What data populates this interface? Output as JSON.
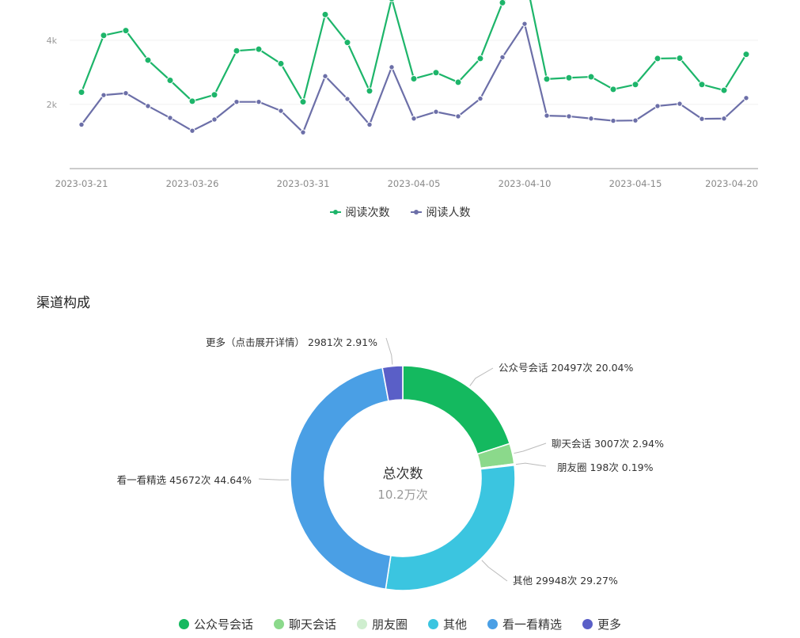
{
  "colors": {
    "reads": "#1db56a",
    "readers": "#6c6fa8",
    "axis": "#cccccc",
    "grid": "#f0f0f0"
  },
  "chart_data": [
    {
      "type": "line",
      "title": "",
      "xlabel": "",
      "ylabel": "",
      "x": [
        "2023-03-21",
        "2023-03-22",
        "2023-03-23",
        "2023-03-24",
        "2023-03-25",
        "2023-03-26",
        "2023-03-27",
        "2023-03-28",
        "2023-03-29",
        "2023-03-30",
        "2023-03-31",
        "2023-04-01",
        "2023-04-02",
        "2023-04-03",
        "2023-04-04",
        "2023-04-05",
        "2023-04-06",
        "2023-04-07",
        "2023-04-08",
        "2023-04-09",
        "2023-04-10",
        "2023-04-11",
        "2023-04-12",
        "2023-04-13",
        "2023-04-14",
        "2023-04-15",
        "2023-04-16",
        "2023-04-17",
        "2023-04-18",
        "2023-04-19",
        "2023-04-20"
      ],
      "x_tick_labels": [
        "2023-03-21",
        "2023-03-26",
        "2023-03-31",
        "2023-04-05",
        "2023-04-10",
        "2023-04-15",
        "2023-04-20"
      ],
      "y_tick_labels": [
        "2k",
        "4k"
      ],
      "y_ticks": [
        2000,
        4000
      ],
      "ylim": [
        0,
        5500
      ],
      "grid": true,
      "legend": "bottom",
      "series": [
        {
          "name": "阅读次数",
          "values": [
            2380,
            4150,
            4300,
            3380,
            2750,
            2100,
            2300,
            3670,
            3720,
            3270,
            2080,
            4800,
            3930,
            2420,
            5300,
            2800,
            2990,
            2690,
            3430,
            5170,
            6100,
            2790,
            2830,
            2860,
            2470,
            2620,
            3430,
            3440,
            2620,
            2440,
            3560
          ]
        },
        {
          "name": "阅读人数",
          "values": [
            1370,
            2290,
            2350,
            1950,
            1580,
            1180,
            1530,
            2080,
            2080,
            1800,
            1130,
            2880,
            2170,
            1370,
            3160,
            1560,
            1770,
            1630,
            2180,
            3470,
            4510,
            1650,
            1630,
            1560,
            1490,
            1500,
            1950,
            2020,
            1550,
            1560,
            2200
          ]
        }
      ]
    },
    {
      "type": "pie",
      "title": "渠道构成",
      "center_label": "总次数",
      "center_value": "10.2万次",
      "legend": "bottom",
      "slices": [
        {
          "name": "公众号会话",
          "value": 20497,
          "label": "公众号会话 20497次 20.04%",
          "color": "#14b95f"
        },
        {
          "name": "聊天会话",
          "value": 3007,
          "label": "聊天会话 3007次 2.94%",
          "color": "#8bd98b"
        },
        {
          "name": "朋友圈",
          "value": 198,
          "label": "朋友圈 198次 0.19%",
          "color": "#cfeecf"
        },
        {
          "name": "其他",
          "value": 29948,
          "label": "其他 29948次 29.27%",
          "color": "#3bc5e0"
        },
        {
          "name": "看一看精选",
          "value": 45672,
          "label": "看一看精选 45672次 44.64%",
          "color": "#4a9fe5"
        },
        {
          "name": "更多",
          "value": 2981,
          "label": "更多（点击展开详情） 2981次 2.91%",
          "color": "#5a5fc7"
        }
      ]
    }
  ]
}
